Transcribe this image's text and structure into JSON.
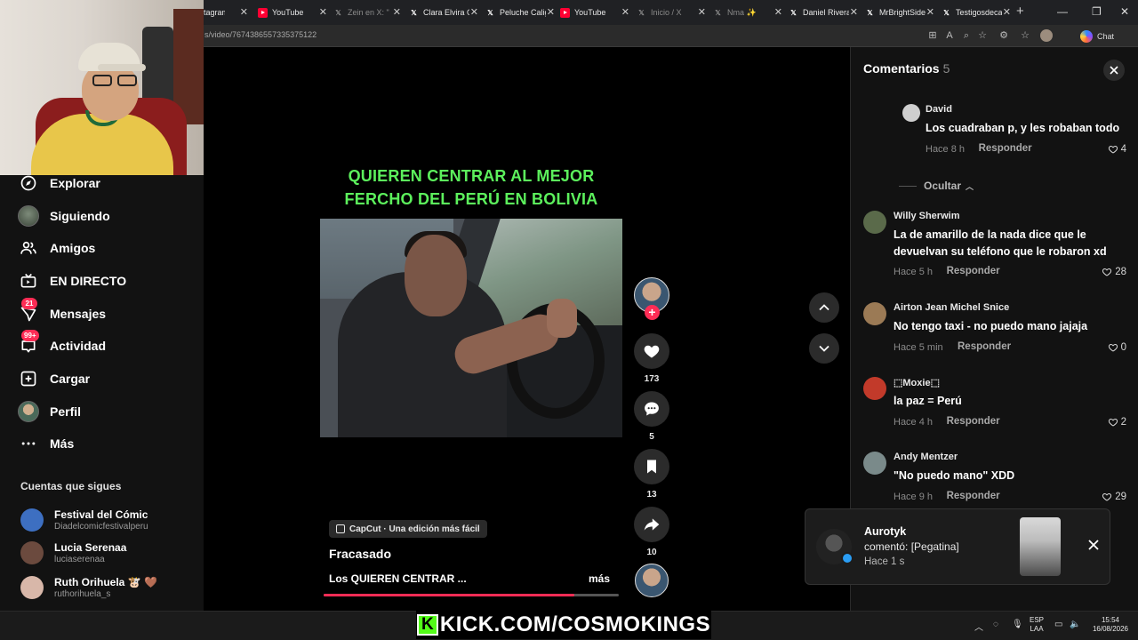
{
  "browser": {
    "tabs": [
      {
        "label": "tagram",
        "fav": ""
      },
      {
        "label": "YouTube",
        "fav": "youtube-icon"
      },
      {
        "label": "Zein en X: \"",
        "fav": "x-icon",
        "dim": true
      },
      {
        "label": "Clara Elvira O",
        "fav": "x-icon"
      },
      {
        "label": "Peluche Calig",
        "fav": "x-icon"
      },
      {
        "label": "YouTube",
        "fav": "youtube-icon"
      },
      {
        "label": "Inicio / X",
        "fav": "x-icon",
        "dim": true
      },
      {
        "label": "Nma ✨ ",
        "fav": "x-icon",
        "dim": true
      },
      {
        "label": "Daniel Rivera",
        "fav": "x-icon"
      },
      {
        "label": "MrBrightSide",
        "fav": "x-icon"
      },
      {
        "label": "Testigosdeca",
        "fav": "x-icon"
      }
    ],
    "url": "s/video/7674386557335375122",
    "chat_label": "Chat"
  },
  "sidebar": {
    "items": [
      {
        "label": "Explorar",
        "icon": "compass-icon"
      },
      {
        "label": "Siguiendo",
        "icon": "avatar-icon"
      },
      {
        "label": "Amigos",
        "icon": "friends-icon"
      },
      {
        "label": "EN DIRECTO",
        "icon": "live-tv-icon"
      },
      {
        "label": "Mensajes",
        "icon": "send-icon",
        "badge": "21"
      },
      {
        "label": "Actividad",
        "icon": "inbox-icon",
        "badge": "99+"
      },
      {
        "label": "Cargar",
        "icon": "upload-plus-icon"
      },
      {
        "label": "Perfil",
        "icon": "profile-avatar-icon"
      },
      {
        "label": "Más",
        "icon": "more-dots-icon"
      }
    ],
    "following_title": "Cuentas que sigues",
    "following": [
      {
        "name": "Festival del Cómic",
        "handle": "Diadelcomicfestivalperu",
        "color": "#3d6fc1"
      },
      {
        "name": "Lucia Serenaa",
        "handle": "luciaserenaa",
        "color": "#6b4a3e"
      },
      {
        "name": "Ruth Orihuela 🐮 🤎",
        "handle": "ruthorihuela_s",
        "color": "#d8b7a9"
      }
    ]
  },
  "video": {
    "title_line1": "QUIEREN CENTRAR AL MEJOR",
    "title_line2": "FERCHO DEL PERÚ EN BOLIVIA",
    "capcut_label": "CapCut · Una edición más fácil",
    "author": "Fracasado",
    "description": "Los QUIEREN CENTRAR ...",
    "more_label": "más",
    "progress": 0.85,
    "likes": "173",
    "comments": "5",
    "saves": "13",
    "shares": "10"
  },
  "comments_panel": {
    "title": "Comentarios",
    "count": "5",
    "hide_label": "Ocultar",
    "reply_label": "Responder",
    "items": [
      {
        "name": "David",
        "text": "Los cuadraban p, y les robaban todo",
        "time": "Hace 8 h",
        "likes": "4",
        "color": "#cfcfcf"
      },
      {
        "name": "Willy Sherwim",
        "text": "La de amarillo de la nada dice que le devuelvan su teléfono que le robaron xd",
        "time": "Hace 5 h",
        "likes": "28",
        "color": "#5a6a4a"
      },
      {
        "name": "Airton Jean Michel Snice",
        "text": "No tengo taxi - no puedo mano jajaja",
        "time": "Hace 5 min",
        "likes": "0",
        "color": "#9b7a55"
      },
      {
        "name": "⬚Moxie⬚",
        "text": "la paz = Perú",
        "time": "Hace 4 h",
        "likes": "2",
        "color": "#c23a2a"
      },
      {
        "name": "Andy Mentzer",
        "text": "\"No puedo mano\" XDD",
        "time": "Hace 9 h",
        "likes": "29",
        "color": "#7a8a8a"
      }
    ]
  },
  "notification": {
    "name": "Aurotyk",
    "text": "comentó: [Pegatina]",
    "time": "Hace 1 s"
  },
  "overlay": {
    "kick_logo": "K",
    "kick_text": "KICK.COM/COSMOKINGS"
  },
  "taskbar": {
    "lang_top": "ESP",
    "lang_bottom": "LAA",
    "time": "15:54",
    "date": "16/08/2026"
  }
}
